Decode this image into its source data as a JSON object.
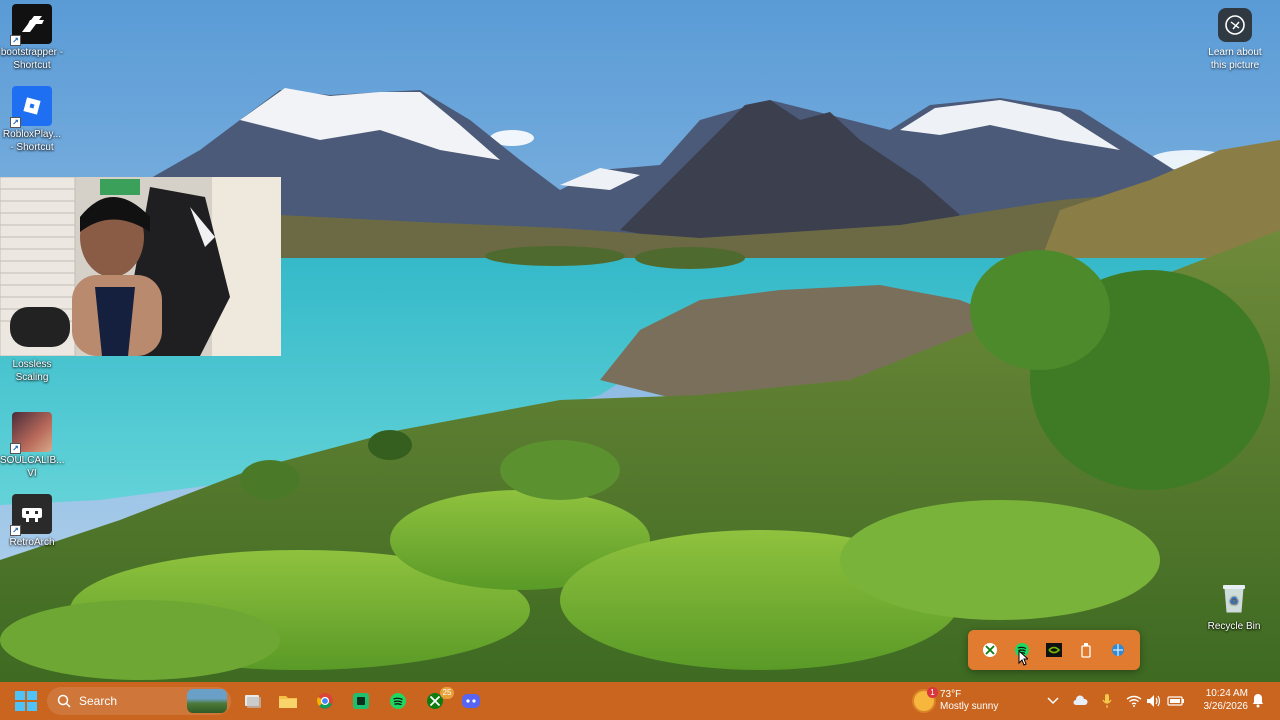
{
  "desktop": {
    "icons": [
      {
        "name": "bootstrapper-shortcut",
        "label": "bootstrapper - Shortcut",
        "glyph": "R"
      },
      {
        "name": "robloxplayer-shortcut",
        "label": "RobloxPlay... - Shortcut",
        "glyph": "▣"
      },
      {
        "name": "lossless-scaling",
        "label": "Lossless Scaling",
        "glyph": ""
      },
      {
        "name": "soulcalibur",
        "label": "SOULCALIB... VI",
        "glyph": ""
      },
      {
        "name": "retroarch",
        "label": "RetroArch",
        "glyph": "👾"
      },
      {
        "name": "recycle-bin",
        "label": "Recycle Bin",
        "glyph": "♻"
      }
    ],
    "learn_label": "Learn about this picture"
  },
  "tray_flyout": {
    "icons": [
      "xbox-icon",
      "spotify-icon",
      "nvidia-icon",
      "usb-icon",
      "network-icon"
    ]
  },
  "taskbar": {
    "search_placeholder": "Search",
    "apps": [
      {
        "name": "task-view-icon",
        "label": "Task View"
      },
      {
        "name": "file-explorer-icon",
        "label": "File Explorer"
      },
      {
        "name": "chrome-icon",
        "label": "Chrome"
      },
      {
        "name": "app-icon",
        "label": "App"
      },
      {
        "name": "spotify-icon",
        "label": "Spotify"
      },
      {
        "name": "xbox-icon",
        "label": "Xbox",
        "badge": "25"
      },
      {
        "name": "discord-icon",
        "label": "Discord"
      }
    ],
    "weather": {
      "temp": "73°F",
      "condition": "Mostly sunny",
      "badge": "1"
    },
    "clock": {
      "time": "10:24 AM",
      "date": "3/26/2026"
    }
  },
  "colors": {
    "taskbar": "#c9651f",
    "flyout": "#e07b2f",
    "water": "#3fc4cf"
  }
}
